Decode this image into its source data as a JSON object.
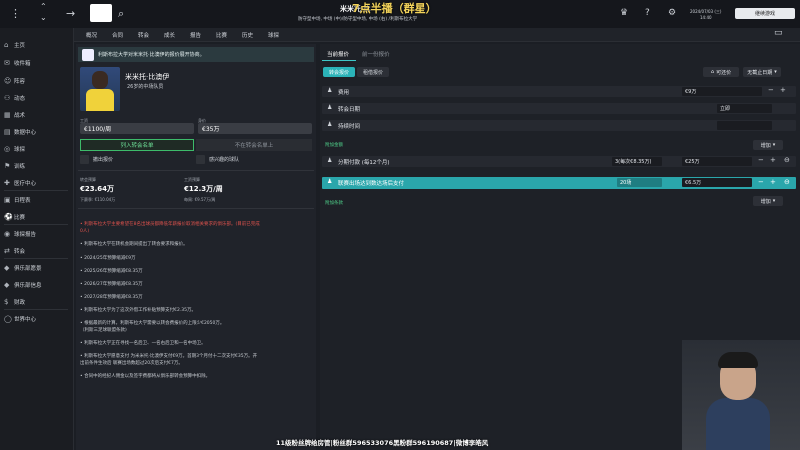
{
  "topbar": {
    "title": "米米托·比",
    "overlay": "7点半播（群星）",
    "subtitle": "防守型中场, 中场 (中)/防守型中场, 中场 (右) /利斯布拉大学",
    "date": "2024/07/03 (三)",
    "time": "14:40",
    "continue_label": "继续游戏"
  },
  "sidebar": {
    "items": [
      {
        "label": "主页",
        "icon": "home-icon"
      },
      {
        "label": "收件箱",
        "icon": "inbox-icon"
      },
      {
        "label": "阵容",
        "icon": "squad-icon"
      },
      {
        "label": "动态",
        "icon": "dynamics-icon"
      },
      {
        "label": "战术",
        "icon": "tactics-icon"
      },
      {
        "label": "数据中心",
        "icon": "data-icon"
      },
      {
        "label": "球探",
        "icon": "scouting-icon"
      },
      {
        "label": "训练",
        "icon": "training-icon"
      },
      {
        "label": "医疗中心",
        "icon": "medical-icon"
      },
      {
        "label": "日程表",
        "icon": "calendar-icon"
      },
      {
        "label": "比赛",
        "icon": "match-icon"
      },
      {
        "label": "球探报告",
        "icon": "report-icon"
      },
      {
        "label": "转会",
        "icon": "transfer-icon"
      },
      {
        "label": "俱乐部愿景",
        "icon": "vision-icon"
      },
      {
        "label": "俱乐部信息",
        "icon": "info-icon"
      },
      {
        "label": "财政",
        "icon": "finance-icon"
      },
      {
        "label": "世界中心",
        "icon": "world-icon"
      }
    ]
  },
  "navbar": {
    "items": [
      "概况",
      "合同",
      "转会",
      "成长",
      "报告",
      "比赛",
      "历史",
      "球探"
    ]
  },
  "left": {
    "banner": "利斯布拉大学对米米托·比澳伊的报价展开协商。",
    "player_name": "米米托·比澳伊",
    "player_info": "26岁的中场队员",
    "wage_label": "工资",
    "wage_value": "€1100/周",
    "value_label": "身价",
    "value_value": "€35万",
    "shortlist_label": "列入转会名单",
    "not_listed_label": "不在转会名单上",
    "check1": "撤出报价",
    "check2": "感兴趣的球队",
    "budget_label": "转会预算",
    "budget_value": "€23.64万",
    "budget_sub": "下赛季: €110.04万",
    "wage_budget_label": "工资预算",
    "wage_budget_value": "€12.3万/周",
    "wage_budget_sub": "每周: €9.57万/周",
    "notes": [
      {
        "text": "• 利斯布拉大学主要希望在8名出球员都降低年薪报价取消相关要求的俱乐部。(目前已完成",
        "red": true
      },
      {
        "text": "0人)",
        "red": true
      },
      {
        "text": "• 利斯布拉大学在转机会期间提出了转会要求和报价。",
        "red": false
      },
      {
        "text": "• 2024/25年预算缩减€9万",
        "red": false
      },
      {
        "text": "• 2025/26年预算缩减€8.35万",
        "red": false
      },
      {
        "text": "• 2026/27年预算缩减€8.35万",
        "red": false
      },
      {
        "text": "• 2027/28年预算缩减€8.35万",
        "red": false
      },
      {
        "text": "• 利斯布拉大学为了这次外借工作补贴预算支付€2.35万。",
        "red": false
      },
      {
        "text": "• 根据最新的计算，利斯布拉大学需要以转会费报价的上限少€2050万。",
        "red": false
      },
      {
        "text": "（利斯三足球联盟条款)",
        "red": false
      },
      {
        "text": "• 利斯布拉大学正在寻找一名后卫、一名右后卫和一名中场卫。",
        "red": false
      },
      {
        "text": "• 利斯布拉大学愿意支付 为米米托·比澳伊支付€9万。首期3个月付十二次支付€35万。开",
        "red": false
      },
      {
        "text": "出前条件生效后 联赛出场数超过20次后支付€7万。",
        "red": false
      },
      {
        "text": "• 合同中的经纪人佣金以及签字费都将从俱乐部转会预算中扣除。",
        "red": false
      }
    ]
  },
  "right": {
    "tab_current": "当前报价",
    "tab_prev": "前一份报价",
    "pill_transfer": "转会报价",
    "pill_loan": "租借报价",
    "negotiable_label": "可还价",
    "deadline_label": "无截止日期",
    "rows": [
      {
        "label": "费用",
        "value": "€9万"
      },
      {
        "label": "转会日期",
        "value": "立即"
      },
      {
        "label": "持续时间",
        "value": ""
      }
    ],
    "extra_label": "附加金额",
    "add_label": "增加",
    "installment_label": "分期付款 (每12个月)",
    "installment_count": "3(每次€8.35万)",
    "installment_value": "€25万",
    "appearance_label": "联赛出场达到数达场后支付",
    "appearance_count": "20场",
    "appearance_value": "€6.5万",
    "conditions_label": "附加条款",
    "add_label2": "增加"
  },
  "caption": "11级粉丝牌给房管|粉丝群596533076黑粉群596190687|微博李皓风"
}
